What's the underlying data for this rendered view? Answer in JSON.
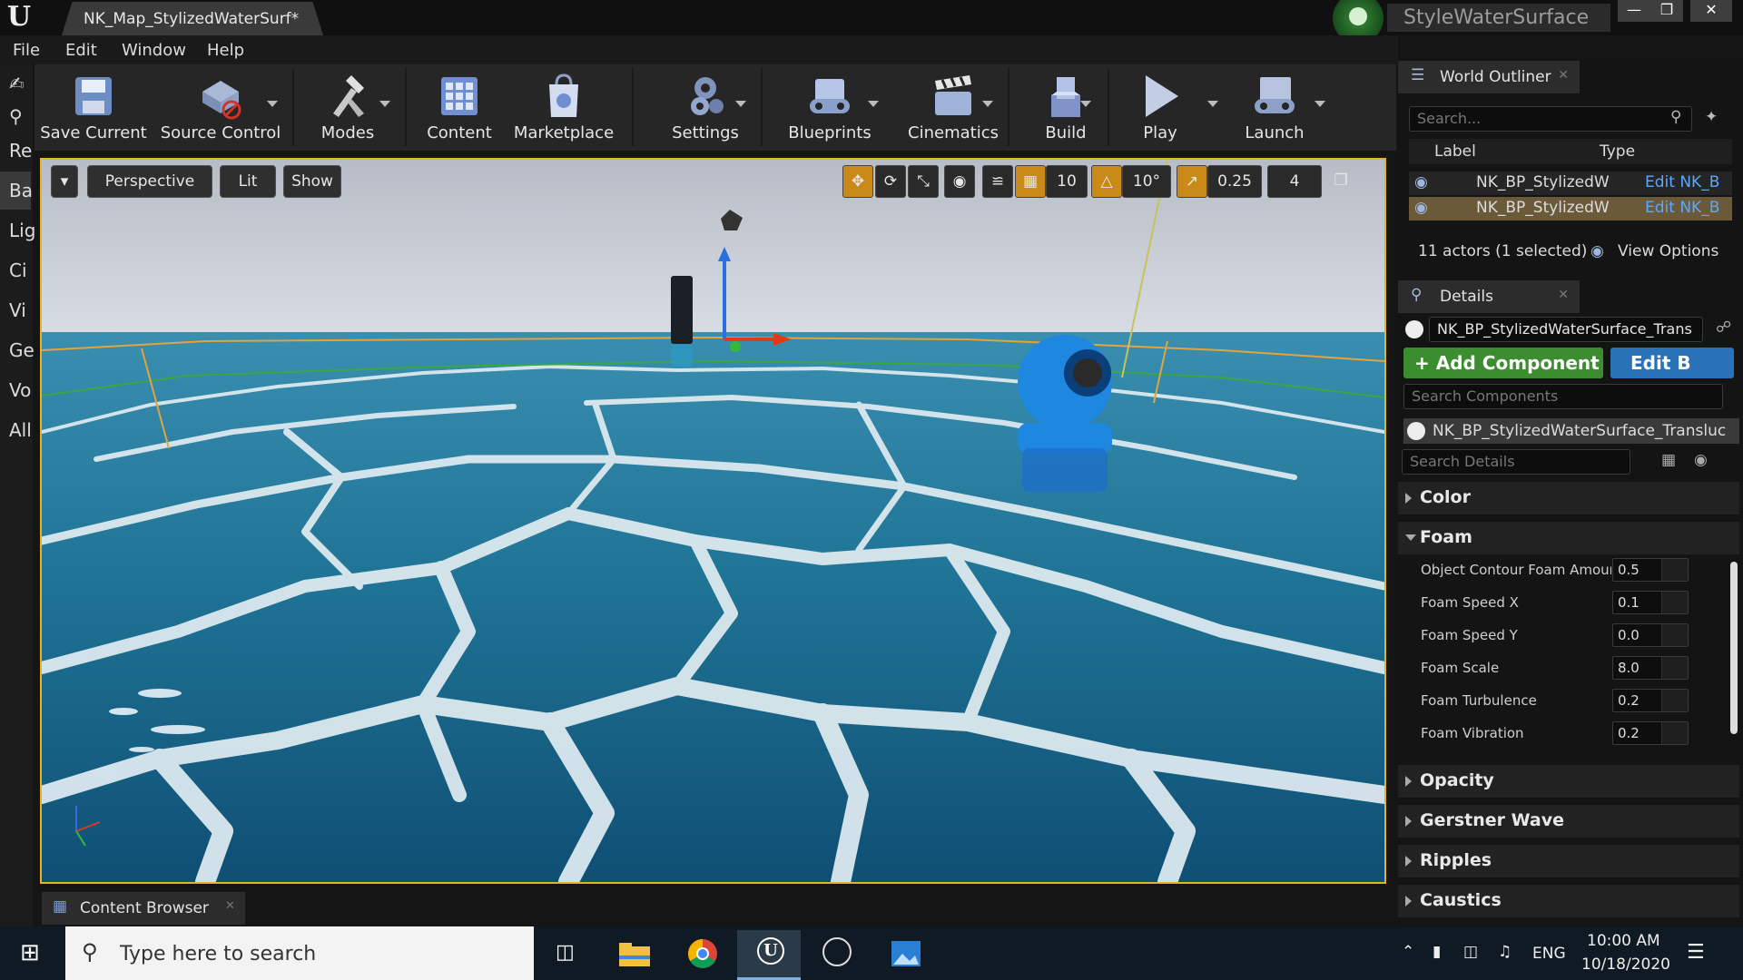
{
  "window": {
    "document_tab": "NK_Map_StylizedWaterSurf*",
    "project_name": "StyleWaterSurface",
    "controls": [
      "minimize",
      "restore",
      "close"
    ]
  },
  "menu": [
    "File",
    "Edit",
    "Window",
    "Help"
  ],
  "mode_tabs": [
    "Re",
    "Ba",
    "Lig",
    "Ci",
    "Vi",
    "Ge",
    "Vo",
    "All"
  ],
  "toolbar": {
    "buttons": [
      {
        "label": "Save Current",
        "icon": "save-icon"
      },
      {
        "label": "Source Control",
        "icon": "source-control-icon"
      },
      {
        "label": "Modes",
        "icon": "modes-icon"
      },
      {
        "label": "Content",
        "icon": "content-icon"
      },
      {
        "label": "Marketplace",
        "icon": "marketplace-icon"
      },
      {
        "label": "Settings",
        "icon": "settings-icon"
      },
      {
        "label": "Blueprints",
        "icon": "blueprints-icon"
      },
      {
        "label": "Cinematics",
        "icon": "cinematics-icon"
      },
      {
        "label": "Build",
        "icon": "build-icon"
      },
      {
        "label": "Play",
        "icon": "play-icon"
      },
      {
        "label": "Launch",
        "icon": "launch-icon"
      }
    ]
  },
  "viewport": {
    "view_mode": "Perspective",
    "lighting": "Lit",
    "show": "Show",
    "grid_snap": "10",
    "rotation_snap": "10°",
    "scale_snap": "0.25",
    "camera_speed": "4",
    "colors": {
      "border": "#e6b422",
      "water": "#1d6f8c",
      "foam": "#d9e8ee",
      "accent": "#c98a1a"
    }
  },
  "world_outliner": {
    "title": "World Outliner",
    "search_placeholder": "Search...",
    "columns": [
      "Label",
      "Type"
    ],
    "rows": [
      {
        "label": "NK_BP_StylizedW",
        "type": "Edit NK_B"
      },
      {
        "label": "NK_BP_StylizedW",
        "type": "Edit NK_B"
      }
    ],
    "actor_count": "11 actors (1 selected)",
    "view_options": "View Options"
  },
  "details": {
    "title": "Details",
    "selected_actor": "NK_BP_StylizedWaterSurface_Trans",
    "add_component": "Add Component",
    "edit_blueprint": "Edit B",
    "search_components": "Search Components",
    "component": "NK_BP_StylizedWaterSurface_Transluc",
    "search_details": "Search Details",
    "categories_top": [
      "Color",
      "Foam"
    ],
    "foam_props": [
      {
        "name": "Object Contour Foam Amoun",
        "value": "0.5"
      },
      {
        "name": "Foam Speed X",
        "value": "0.1"
      },
      {
        "name": "Foam Speed Y",
        "value": "0.0"
      },
      {
        "name": "Foam Scale",
        "value": "8.0"
      },
      {
        "name": "Foam Turbulence",
        "value": "0.2"
      },
      {
        "name": "Foam Vibration",
        "value": "0.2"
      }
    ],
    "categories_bottom": [
      "Opacity",
      "Gerstner Wave",
      "Ripples",
      "Caustics"
    ]
  },
  "content_browser": {
    "title": "Content Browser"
  },
  "taskbar": {
    "search_placeholder": "Type here to search",
    "apps": [
      "task-view",
      "file-explorer",
      "chrome",
      "unreal-engine",
      "obs-studio",
      "photos"
    ],
    "language": "ENG",
    "time": "10:00 AM",
    "date": "10/18/2020"
  }
}
